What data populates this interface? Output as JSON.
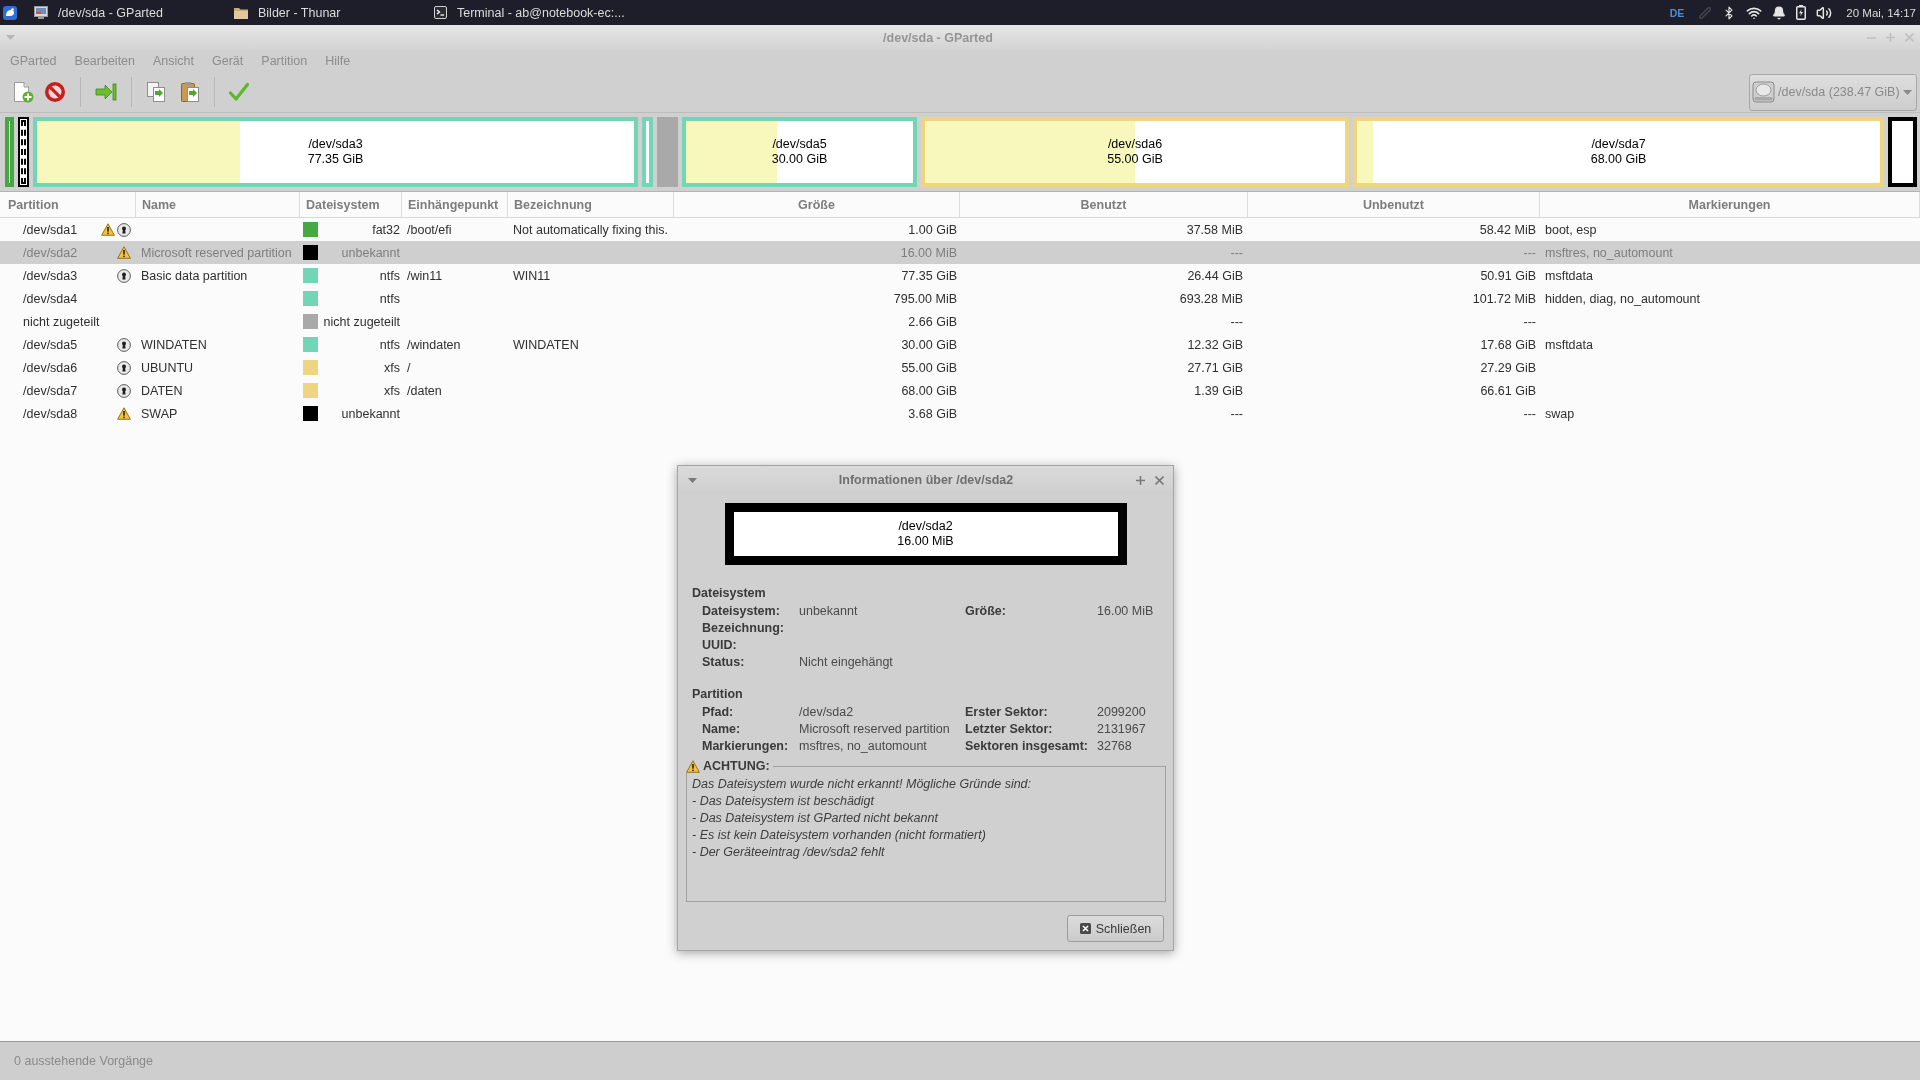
{
  "taskbar": {
    "tasks": [
      {
        "kind": "app",
        "label": "/dev/sda - GParted"
      },
      {
        "kind": "folder",
        "label": "Bilder - Thunar"
      },
      {
        "kind": "terminal",
        "label": "Terminal - ab@notebook-ec:..."
      }
    ],
    "keyboard_layout": "DE",
    "clock": "20 Mai, 14:17"
  },
  "window": {
    "title": "/dev/sda - GParted"
  },
  "menu": [
    "GParted",
    "Bearbeiten",
    "Ansicht",
    "Gerät",
    "Partition",
    "Hilfe"
  ],
  "device": "/dev/sda (238.47 GiB)",
  "partition_map": [
    {
      "kind": "partition",
      "color": "#45a845",
      "selected": false
    },
    {
      "kind": "partition",
      "color": "#000000",
      "selected": true
    },
    {
      "kind": "partition",
      "path": "/dev/sda3",
      "size": "77.35 GiB",
      "color": "#72d5b5",
      "level": 0.34,
      "selected": false
    },
    {
      "kind": "partition",
      "color": "#72d5b5",
      "selected": false
    },
    {
      "kind": "unallocated",
      "color": "#a9a9a9",
      "selected": false
    },
    {
      "kind": "partition",
      "path": "/dev/sda5",
      "size": "30.00 GiB",
      "color": "#72d5b5",
      "level": 0.4,
      "selected": false
    },
    {
      "kind": "partition",
      "path": "/dev/sda6",
      "size": "55.00 GiB",
      "color": "#eed680",
      "level": 0.5,
      "selected": false
    },
    {
      "kind": "partition",
      "path": "/dev/sda7",
      "size": "68.00 GiB",
      "color": "#eed680",
      "level": 0.03,
      "selected": false
    },
    {
      "kind": "partition",
      "color": "#000000",
      "selected": false
    }
  ],
  "table": {
    "columns": [
      "Partition",
      "Name",
      "Dateisystem",
      "Einhängepunkt",
      "Bezeichnung",
      "Größe",
      "Benutzt",
      "Unbenutzt",
      "Markierungen"
    ],
    "rows": [
      {
        "partition": "/dev/sda1",
        "warning": true,
        "locked": true,
        "filesystem": "fat32",
        "color": "#45a845",
        "mount_point": "/boot/efi",
        "label": "Not automatically fixing this.",
        "size": "1.00 GiB",
        "used": "37.58 MiB",
        "unused": "58.42 MiB",
        "flags": "boot, esp",
        "selected": false
      },
      {
        "partition": "/dev/sda2",
        "warning": true,
        "locked": false,
        "name": "Microsoft reserved partition",
        "filesystem": "unbekannt",
        "color": "#000000",
        "size": "16.00 MiB",
        "used": "---",
        "unused": "---",
        "flags": "msftres, no_automount",
        "selected": true
      },
      {
        "partition": "/dev/sda3",
        "warning": false,
        "locked": true,
        "name": "Basic data partition",
        "filesystem": "ntfs",
        "color": "#72d5b5",
        "mount_point": "/win11",
        "label": "WIN11",
        "size": "77.35 GiB",
        "used": "26.44 GiB",
        "unused": "50.91 GiB",
        "flags": "msftdata",
        "selected": false
      },
      {
        "partition": "/dev/sda4",
        "warning": false,
        "locked": false,
        "filesystem": "ntfs",
        "color": "#72d5b5",
        "size": "795.00 MiB",
        "used": "693.28 MiB",
        "unused": "101.72 MiB",
        "flags": "hidden, diag, no_automount",
        "selected": false
      },
      {
        "partition": "nicht zugeteilt",
        "warning": false,
        "locked": false,
        "filesystem": "nicht zugeteilt",
        "color": "#a9a9a9",
        "size": "2.66 GiB",
        "used": "---",
        "unused": "---",
        "selected": false
      },
      {
        "partition": "/dev/sda5",
        "warning": false,
        "locked": true,
        "name": "WINDATEN",
        "filesystem": "ntfs",
        "color": "#72d5b5",
        "mount_point": "/windaten",
        "label": "WINDATEN",
        "size": "30.00 GiB",
        "used": "12.32 GiB",
        "unused": "17.68 GiB",
        "flags": "msftdata",
        "selected": false
      },
      {
        "partition": "/dev/sda6",
        "warning": false,
        "locked": true,
        "name": "UBUNTU",
        "filesystem": "xfs",
        "color": "#eed680",
        "mount_point": "/",
        "size": "55.00 GiB",
        "used": "27.71 GiB",
        "unused": "27.29 GiB",
        "selected": false
      },
      {
        "partition": "/dev/sda7",
        "warning": false,
        "locked": true,
        "name": "DATEN",
        "filesystem": "xfs",
        "color": "#eed680",
        "mount_point": "/daten",
        "size": "68.00 GiB",
        "used": "1.39 GiB",
        "unused": "66.61 GiB",
        "selected": false
      },
      {
        "partition": "/dev/sda8",
        "warning": true,
        "locked": false,
        "name": "SWAP",
        "filesystem": "unbekannt",
        "color": "#000000",
        "size": "3.68 GiB",
        "used": "---",
        "unused": "---",
        "flags": "swap",
        "selected": false
      }
    ]
  },
  "status_bar": "0 ausstehende Vorgänge",
  "info_dialog": {
    "title": "Informationen über /dev/sda2",
    "graphic": {
      "path": "/dev/sda2",
      "size": "16.00 MiB",
      "color": "#000000"
    },
    "sections": [
      {
        "heading": "Dateisystem",
        "left": [
          {
            "label": "Dateisystem:",
            "value": "unbekannt"
          },
          {
            "label": "Bezeichnung:"
          },
          {
            "label": "UUID:"
          },
          {
            "label": "Status:",
            "value": "Nicht eingehängt"
          }
        ],
        "right": [
          {
            "label": "Größe:",
            "value": "16.00 MiB"
          }
        ]
      },
      {
        "heading": "Partition",
        "left": [
          {
            "label": "Pfad:",
            "value": "/dev/sda2"
          },
          {
            "label": "Name:",
            "value": "Microsoft reserved partition"
          },
          {
            "label": "Markierungen:",
            "value": "msftres, no_automount"
          }
        ],
        "right": [
          {
            "label": "Erster Sektor:",
            "value": "2099200"
          },
          {
            "label": "Letzter Sektor:",
            "value": "2131967"
          },
          {
            "label": "Sektoren insgesamt:",
            "value": "32768"
          }
        ]
      }
    ],
    "warning": {
      "heading": "ACHTUNG:",
      "lines": [
        "Das Dateisystem wurde nicht erkannt! Mögliche Gründe sind:",
        "- Das Dateisystem ist beschädigt",
        "- Das Dateisystem ist GParted nicht bekannt",
        "- Es ist kein Dateisystem vorhanden (nicht formatiert)",
        "- Der Geräteeintrag /dev/sda2 fehlt"
      ]
    },
    "close_button": "Schließen"
  }
}
